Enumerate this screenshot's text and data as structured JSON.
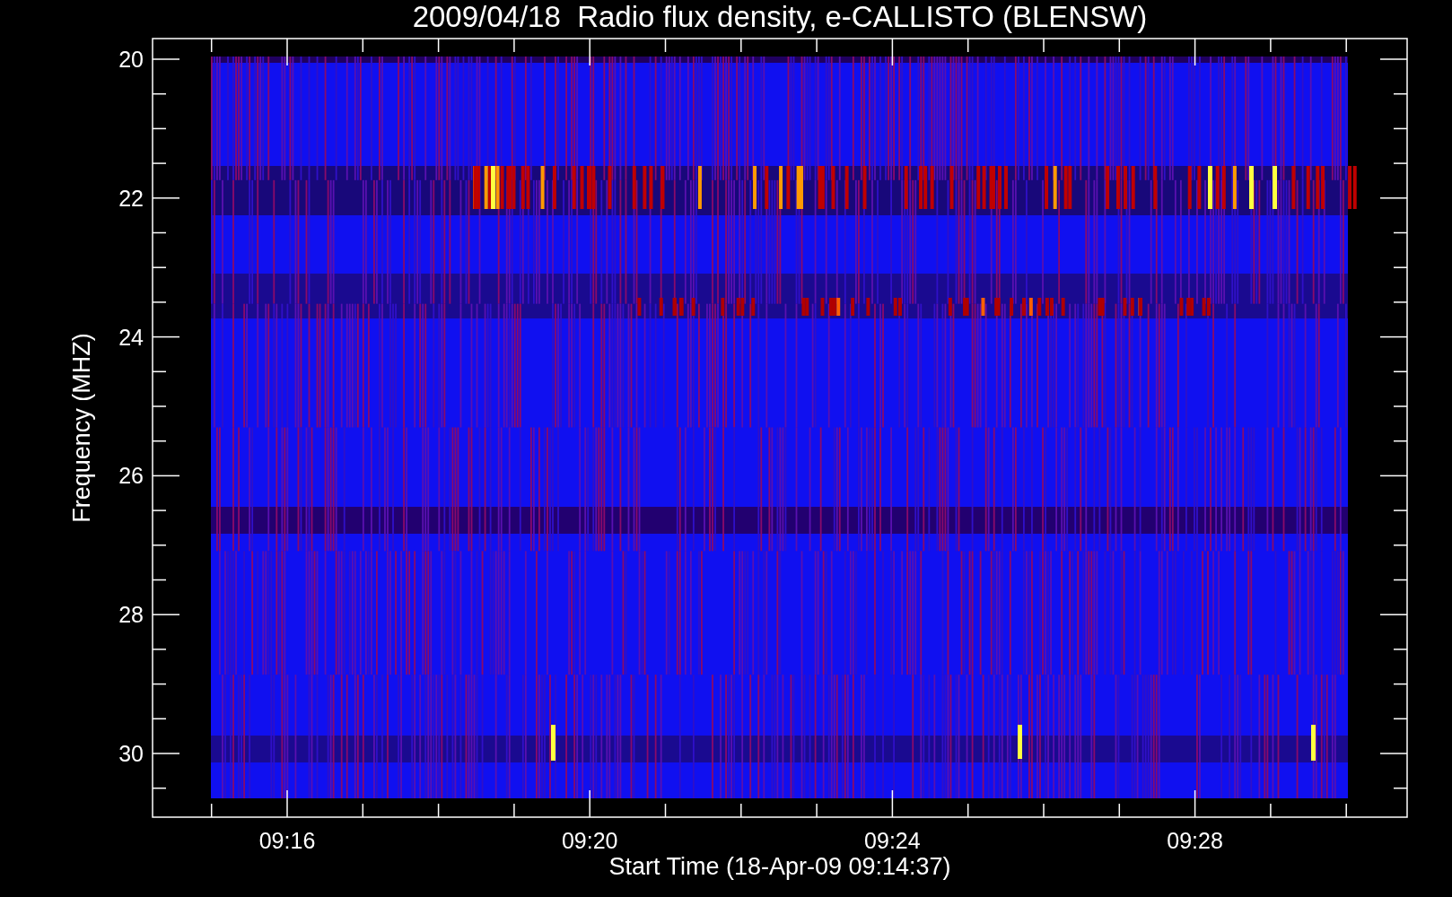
{
  "title": "2009/04/18  Radio flux density, e-CALLISTO (BLENSW)",
  "y_axis": {
    "label": "Frequency (MHZ)",
    "ticks": [
      "20",
      "22",
      "24",
      "26",
      "28",
      "30"
    ]
  },
  "x_axis": {
    "label": "Start Time (18-Apr-09 09:14:37)",
    "ticks": [
      "09:16",
      "09:20",
      "09:24",
      "09:28"
    ]
  }
}
